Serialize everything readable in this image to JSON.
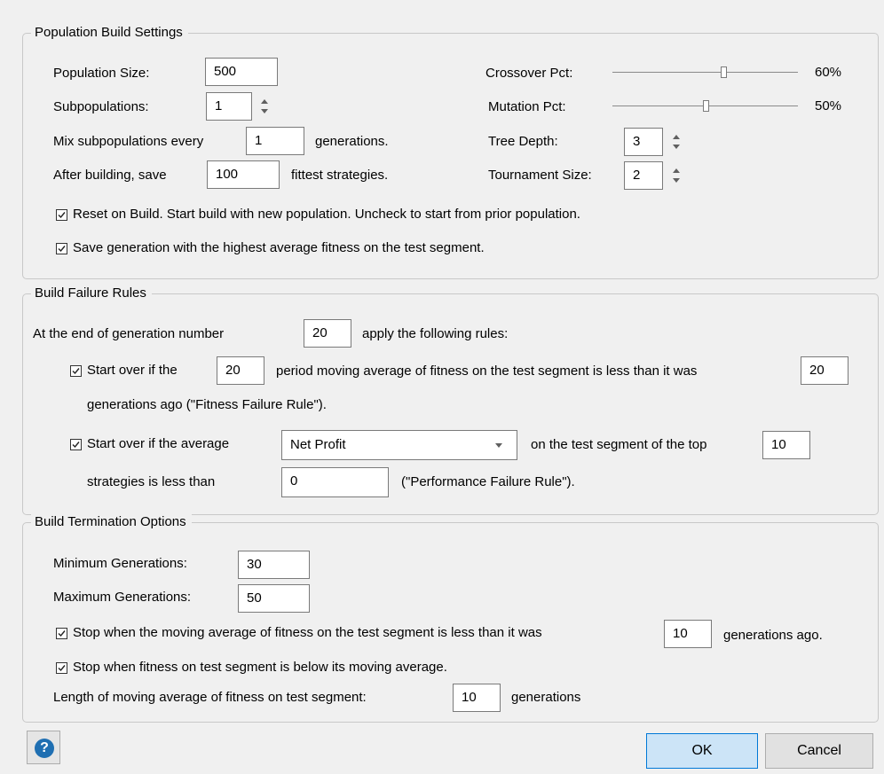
{
  "population_build": {
    "title": "Population Build Settings",
    "population_size_label": "Population Size:",
    "population_size_value": "500",
    "subpopulations_label": "Subpopulations:",
    "subpopulations_value": "1",
    "mix_label_pre": "Mix subpopulations every",
    "mix_value": "1",
    "mix_label_post": "generations.",
    "after_label_pre": "After building, save",
    "after_value": "100",
    "after_label_post": "fittest strategies.",
    "crossover_label": "Crossover Pct:",
    "crossover_pct": 60,
    "crossover_display": "60%",
    "mutation_label": "Mutation Pct:",
    "mutation_pct": 50,
    "mutation_display": "50%",
    "tree_depth_label": "Tree Depth:",
    "tree_depth_value": "3",
    "tournament_label": "Tournament Size:",
    "tournament_value": "2",
    "reset_checkbox_label": "Reset on Build. Start build with new population. Uncheck to start from prior population.",
    "reset_checked": true,
    "save_gen_label": "Save generation with the highest average fitness on the test segment.",
    "save_gen_checked": true
  },
  "failure_rules": {
    "title": "Build Failure Rules",
    "end_gen_pre": "At the end of generation number",
    "end_gen_value": "20",
    "end_gen_post": "apply the following rules:",
    "fitness_rule_checked": true,
    "fitness_rule_pre": "Start over if the",
    "fitness_period_value": "20",
    "fitness_rule_mid": "period moving average of fitness on the test segment is less than it was",
    "fitness_gens_value": "20",
    "fitness_rule_post": "generations ago (\"Fitness Failure Rule\").",
    "perf_rule_checked": true,
    "perf_rule_pre": "Start over if the average",
    "perf_metric_value": "Net Profit",
    "perf_rule_mid": "on the test segment of the top",
    "perf_top_value": "10",
    "perf_rule_line2_pre": "strategies  is less than",
    "perf_threshold_value": "0",
    "perf_rule_post": "(\"Performance Failure Rule\")."
  },
  "termination": {
    "title": "Build Termination Options",
    "min_gen_label": "Minimum Generations:",
    "min_gen_value": "30",
    "max_gen_label": "Maximum Generations:",
    "max_gen_value": "50",
    "stop_ma_checked": true,
    "stop_ma_label": "Stop when the moving average of fitness on the test segment is less than it was",
    "stop_ma_value": "10",
    "stop_ma_post": "generations ago.",
    "stop_below_checked": true,
    "stop_below_label": "Stop when fitness on test segment is below its moving average.",
    "ma_length_label": "Length of moving average of fitness on test segment:",
    "ma_length_value": "10",
    "ma_length_post": "generations"
  },
  "footer": {
    "help_icon": "?",
    "ok_label": "OK",
    "cancel_label": "Cancel"
  }
}
